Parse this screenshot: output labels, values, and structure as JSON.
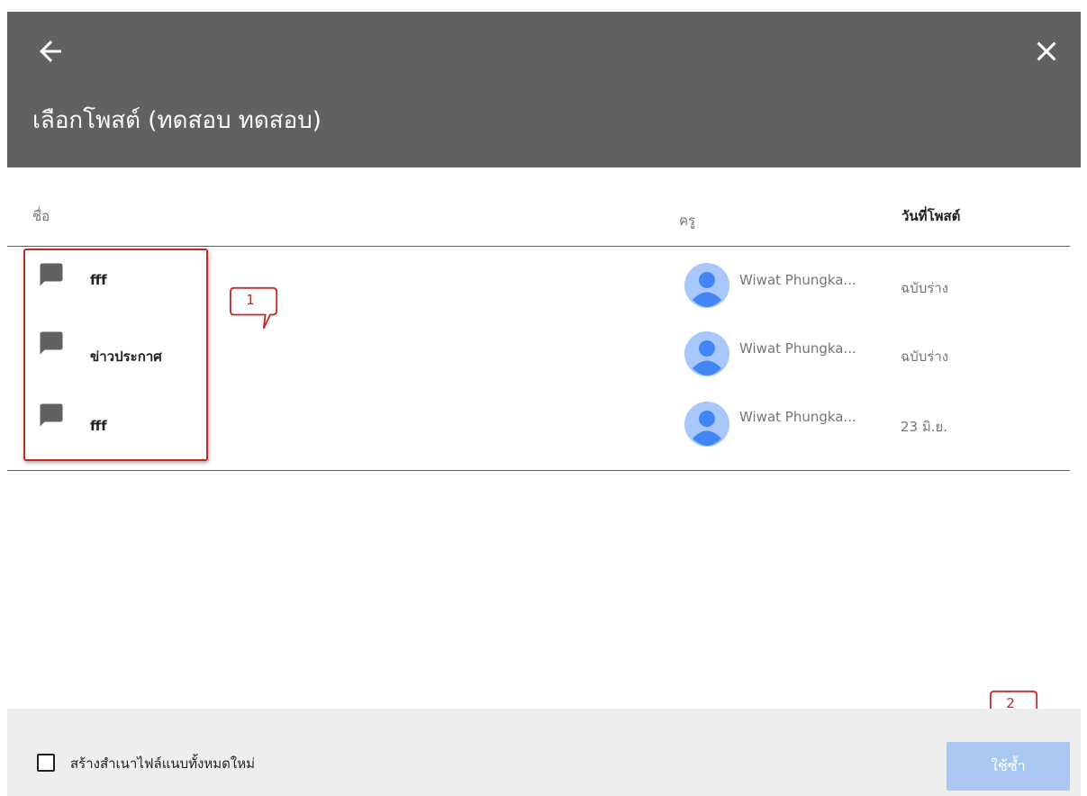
{
  "dialog": {
    "title": "เลือกโพสต์ (ทดสอบ ทดสอบ)",
    "back_icon": "arrow-back-icon",
    "close_icon": "close-icon"
  },
  "columns": {
    "name": "ชื่อ",
    "teacher": "ครู",
    "date": "วันที่โพสต์"
  },
  "posts": [
    {
      "title": "fff",
      "teacher": "Wiwat Phungka...",
      "date": "ฉบับร่าง",
      "icon": "message-icon"
    },
    {
      "title": "ข่าวประกาศ",
      "teacher": "Wiwat Phungka...",
      "date": "ฉบับร่าง",
      "icon": "message-icon"
    },
    {
      "title": "fff",
      "teacher": "Wiwat Phungka...",
      "date": "23 มิ.ย.",
      "icon": "message-icon"
    }
  ],
  "annotations": {
    "callout_1": "1",
    "callout_2": "2"
  },
  "footer": {
    "checkbox_label": "สร้างสำเนาไฟล์แนบทั้งหมดใหม่",
    "checkbox_checked": false,
    "reuse_button": "ใช้ซ้ำ"
  },
  "colors": {
    "header": "#616161",
    "accent_disabled": "#a9c7f0",
    "annotation": "#c62828"
  }
}
